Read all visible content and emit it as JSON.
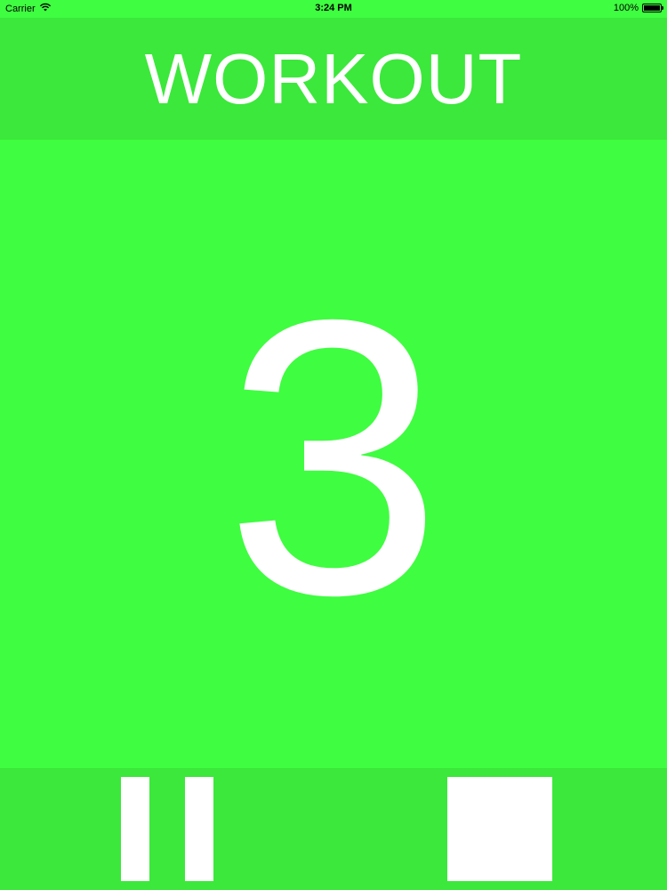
{
  "status_bar": {
    "carrier": "Carrier",
    "time": "3:24 PM",
    "battery_text": "100%",
    "battery_level": 1.0,
    "icons": [
      "wifi-icon",
      "battery-icon"
    ]
  },
  "header": {
    "title": "WORKOUT"
  },
  "main": {
    "countdown": "3"
  },
  "controls": {
    "pause_icon": "pause-icon",
    "stop_icon": "stop-icon"
  },
  "colors": {
    "background": "#3ffd40",
    "band": "#3ce83b",
    "foreground": "#ffffff"
  }
}
